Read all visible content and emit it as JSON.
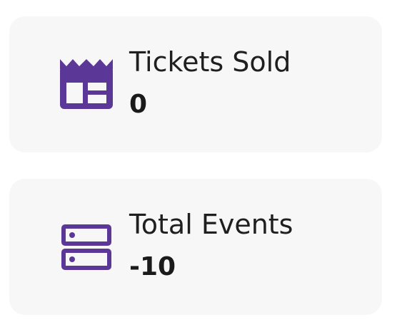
{
  "accent_color": "#5b3897",
  "cards": [
    {
      "icon": "ticket-icon",
      "label": "Tickets Sold",
      "value": "0"
    },
    {
      "icon": "server-icon",
      "label": "Total Events",
      "value": "-10"
    }
  ]
}
